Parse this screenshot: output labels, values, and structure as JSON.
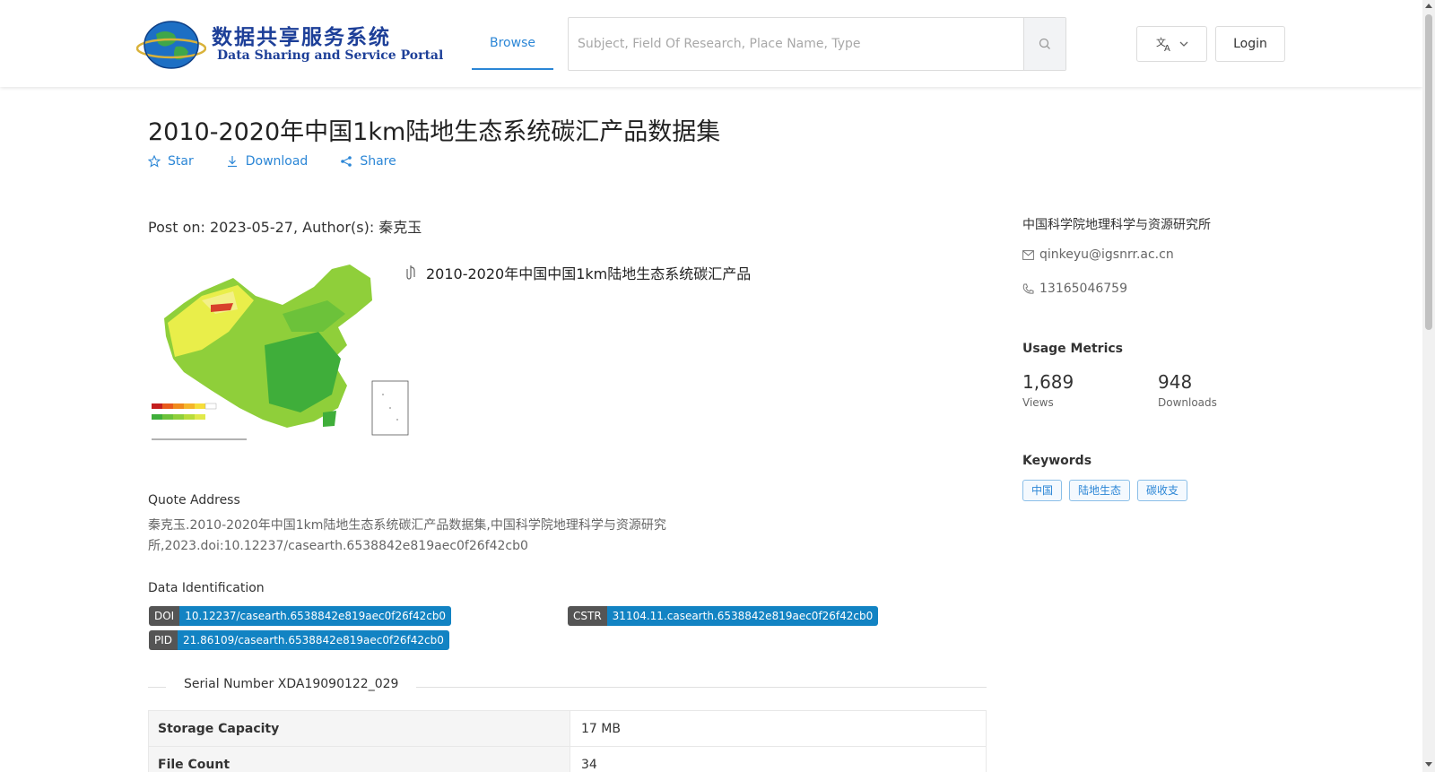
{
  "header": {
    "logo_cn": "数据共享服务系统",
    "logo_en": "Data Sharing and Service Portal",
    "nav_browse": "Browse",
    "search_placeholder": "Subject, Field Of Research, Place Name, Type",
    "login": "Login",
    "accent": "#2b86d6"
  },
  "dataset": {
    "title": "2010-2020年中国1km陆地生态系统碳汇产品数据集",
    "actions": {
      "star": "Star",
      "download": "Download",
      "share": "Share"
    },
    "post_line": "Post on: 2023-05-27, Author(s): 秦克玉",
    "file_title": "2010-2020年中国中国1km陆地生态系统碳汇产品",
    "quote_label": "Quote Address",
    "quote_text": "秦克玉.2010-2020年中国1km陆地生态系统碳汇产品数据集,中国科学院地理科学与资源研究所,2023.doi:10.12237/casearth.6538842e819aec0f26f42cb0",
    "id_label": "Data Identification",
    "ids": {
      "doi_k": "DOI",
      "doi_v": "10.12237/casearth.6538842e819aec0f26f42cb0",
      "cstr_k": "CSTR",
      "cstr_v": "31104.11.casearth.6538842e819aec0f26f42cb0",
      "pid_k": "PID",
      "pid_v": "21.86109/casearth.6538842e819aec0f26f42cb0"
    },
    "serial": "Serial Number XDA19090122_029",
    "table": [
      {
        "k": "Storage Capacity",
        "v": "17 MB"
      },
      {
        "k": "File Count",
        "v": "34"
      }
    ]
  },
  "sidebar": {
    "org": "中国科学院地理科学与资源研究所",
    "email": "qinkeyu@igsnrr.ac.cn",
    "phone": "13165046759",
    "metrics_title": "Usage Metrics",
    "views_num": "1,689",
    "views_label": "Views",
    "downloads_num": "948",
    "downloads_label": "Downloads",
    "keywords_title": "Keywords",
    "keywords": [
      "中国",
      "陆地生态",
      "碳收支"
    ]
  }
}
